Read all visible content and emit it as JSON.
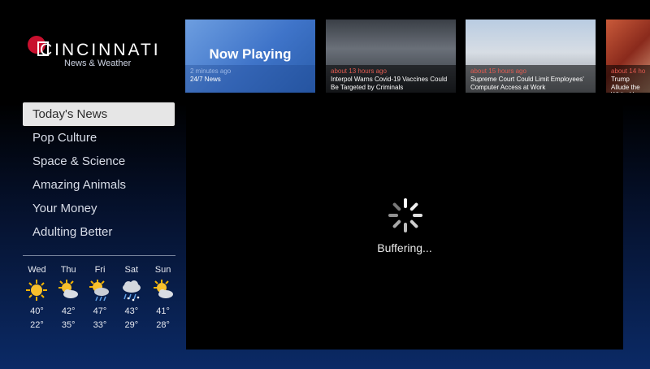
{
  "logo": {
    "name": "CINCINNATI",
    "subtitle": "News & Weather"
  },
  "menu": {
    "items": [
      {
        "label": "Today's News",
        "active": true
      },
      {
        "label": "Pop Culture"
      },
      {
        "label": "Space & Science"
      },
      {
        "label": "Amazing Animals"
      },
      {
        "label": "Your Money"
      },
      {
        "label": "Adulting Better"
      }
    ]
  },
  "weather": {
    "days": [
      {
        "name": "Wed",
        "icon": "sunny-icon",
        "hi": "40°",
        "lo": "22°"
      },
      {
        "name": "Thu",
        "icon": "partly-cloudy-icon",
        "hi": "42°",
        "lo": "35°"
      },
      {
        "name": "Fri",
        "icon": "rain-sun-icon",
        "hi": "47°",
        "lo": "33°"
      },
      {
        "name": "Sat",
        "icon": "snow-rain-icon",
        "hi": "43°",
        "lo": "29°"
      },
      {
        "name": "Sun",
        "icon": "partly-cloudy-icon",
        "hi": "41°",
        "lo": "28°"
      }
    ]
  },
  "thumbnails": [
    {
      "title": "Now Playing",
      "age": "2 minutes ago",
      "headline": "24/7 News"
    },
    {
      "age": "about 13 hours ago",
      "headline": "Interpol Warns Covid-19 Vaccines Could Be Targeted by Criminals"
    },
    {
      "age": "about 15 hours ago",
      "headline": "Supreme Court Could Limit Employees' Computer Access at Work"
    },
    {
      "age": "about 14 ho",
      "headline": "Trump Allude the White Ho"
    }
  ],
  "player": {
    "status": "Buffering..."
  },
  "colors": {
    "accent_red": "#c8102e",
    "menu_active_bg": "#e6e6e6",
    "age_text": "#e05a50"
  }
}
